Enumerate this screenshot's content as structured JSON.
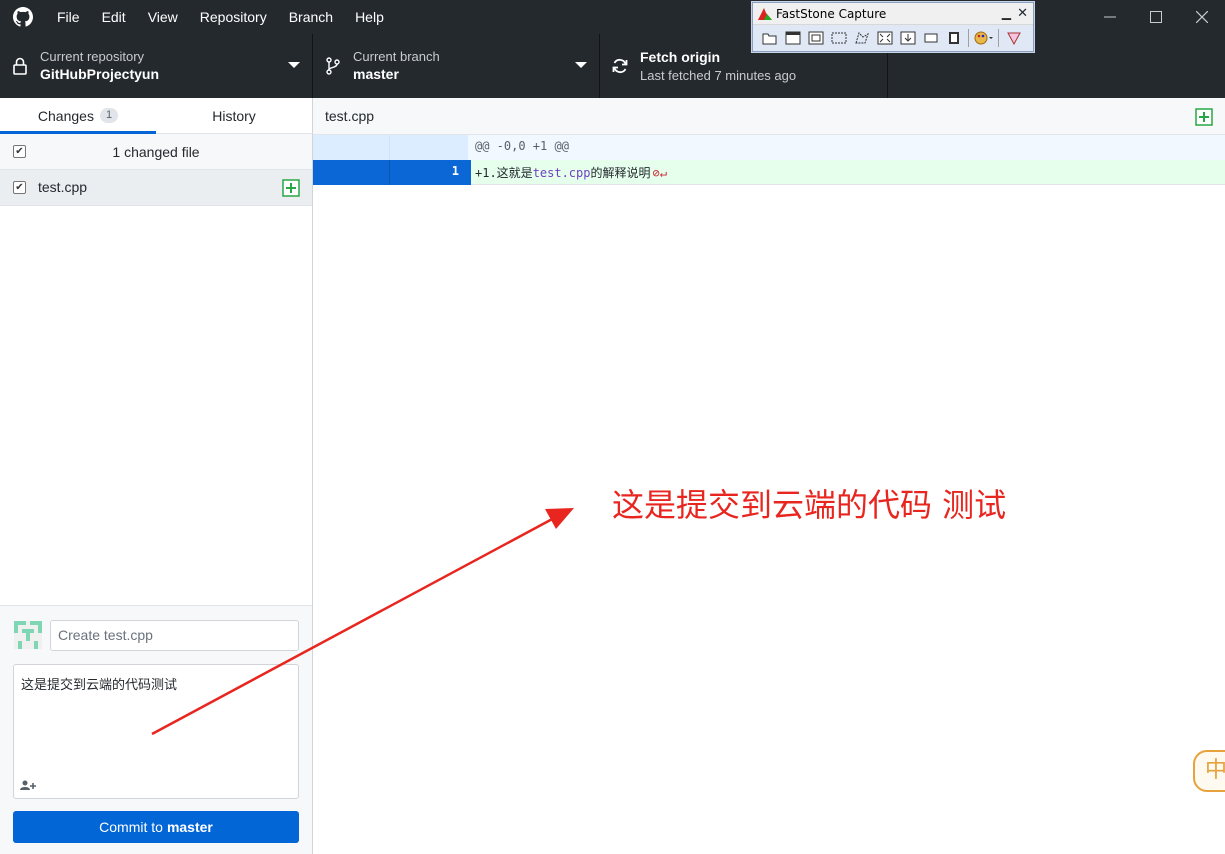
{
  "menu": {
    "file": "File",
    "edit": "Edit",
    "view": "View",
    "repository": "Repository",
    "branch": "Branch",
    "help": "Help"
  },
  "toolbar": {
    "repo_label": "Current repository",
    "repo_value": "GitHubProjectyun",
    "branch_label": "Current branch",
    "branch_value": "master",
    "fetch_label": "Fetch origin",
    "fetch_sub": "Last fetched 7 minutes ago"
  },
  "tabs": {
    "changes": "Changes",
    "changes_count": "1",
    "history": "History"
  },
  "changes": {
    "summary": "1 changed file",
    "files": [
      {
        "name": "test.cpp",
        "checked": true
      }
    ]
  },
  "commit": {
    "summary_placeholder": "Create test.cpp",
    "description": "这是提交到云端的代码测试",
    "button_prefix": "Commit to",
    "button_branch": "master"
  },
  "diff": {
    "filename": "test.cpp",
    "hunk_header": "@@ -0,0 +1 @@",
    "lines": [
      {
        "new_line_no": "1",
        "prefix": "+1.这就是",
        "highlight": "test.cpp",
        "suffix": "的解释说明",
        "no_newline_marker": "⊘↵"
      }
    ]
  },
  "annotation": {
    "text": "这是提交到云端的代码 测试",
    "color": "#e8261f"
  },
  "faststone": {
    "title": "FastStone Capture",
    "minimize": "▁",
    "close": "✕"
  },
  "ime": {
    "label": "中"
  },
  "colors": {
    "titlebar": "#24292e",
    "accent": "#0366d6",
    "added_bg": "#e6ffed",
    "add_icon": "#28a745"
  }
}
